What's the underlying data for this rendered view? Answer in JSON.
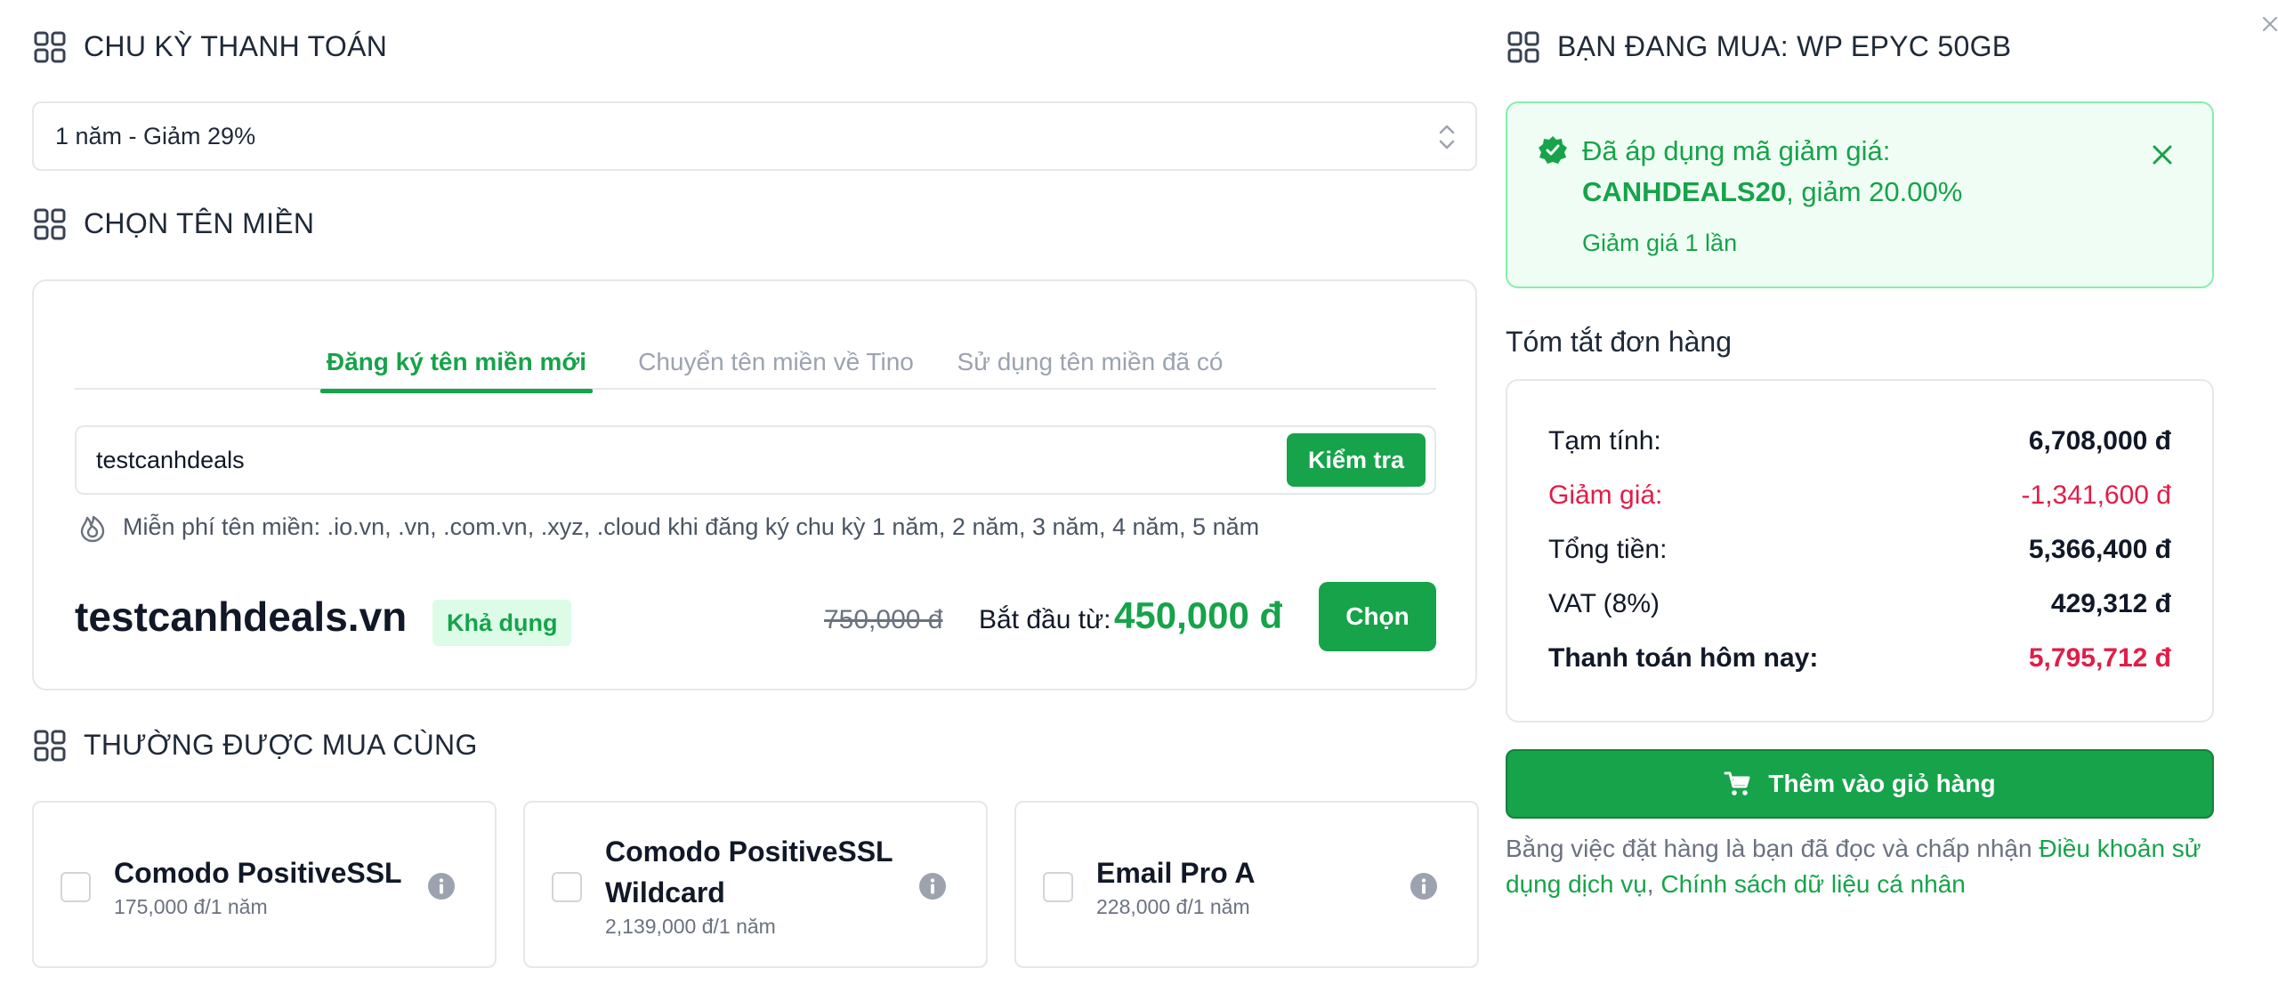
{
  "billing": {
    "section_title": "CHU KỲ THANH TOÁN",
    "selected_option": "1 năm - Giảm 29%"
  },
  "domain": {
    "section_title": "CHỌN TÊN MIỀN",
    "tabs": [
      {
        "label": "Đăng ký tên miền mới",
        "active": true
      },
      {
        "label": "Chuyển tên miền về Tino",
        "active": false
      },
      {
        "label": "Sử dụng tên miền đã có",
        "active": false
      }
    ],
    "search_value": "testcanhdeals",
    "check_button": "Kiểm tra",
    "free_note": "Miễn phí tên miền: .io.vn, .vn, .com.vn, .xyz, .cloud khi đăng ký chu kỳ 1 năm, 2 năm, 3 năm, 4 năm, 5 năm",
    "result": {
      "name": "testcanhdeals.vn",
      "status": "Khả dụng",
      "old_price": "750,000 đ",
      "start_label": "Bắt đầu từ:",
      "new_price": "450,000 đ",
      "choose_button": "Chọn"
    }
  },
  "addons": {
    "section_title": "THƯỜNG ĐƯỢC MUA CÙNG",
    "items": [
      {
        "name": "Comodo PositiveSSL",
        "price": "175,000 đ/1 năm"
      },
      {
        "name": "Comodo PositiveSSL Wildcard",
        "price": "2,139,000 đ/1 năm"
      },
      {
        "name": "Email Pro A",
        "price": "228,000 đ/1 năm"
      }
    ]
  },
  "purchase": {
    "section_title": "BẠN ĐANG MUA: WP EPYC 50GB"
  },
  "promo": {
    "line1": "Đã áp dụng mã giảm giá:",
    "code": "CANHDEALS20",
    "line2_suffix": ", giảm 20.00%",
    "usage": "Giảm giá 1 lần"
  },
  "summary": {
    "title": "Tóm tắt đơn hàng",
    "rows": [
      {
        "label": "Tạm tính:",
        "value": "6,708,000 đ"
      },
      {
        "label": "Giảm giá:",
        "value": "-1,341,600 đ"
      },
      {
        "label": "Tổng tiền:",
        "value": "5,366,400 đ"
      },
      {
        "label": "VAT (8%)",
        "value": "429,312 đ"
      },
      {
        "label": "Thanh toán hôm nay:",
        "value": "5,795,712 đ"
      }
    ]
  },
  "cart_button": "Thêm vào giỏ hàng",
  "terms": {
    "prefix": "Bằng việc đặt hàng là bạn đã đọc và chấp nhận ",
    "link1": "Điều khoản sử dụng dịch vụ",
    "separator": ", ",
    "link2": "Chính sách dữ liệu cá nhân"
  },
  "colors": {
    "brand_green": "#16a34a",
    "discount_red": "#e11d48",
    "promo_bg": "#f0fdf4",
    "border": "#e5e7eb"
  },
  "icons": [
    "grid-icon",
    "select-chevron-icon",
    "fire-icon",
    "info-icon",
    "badge-check-icon",
    "close-icon",
    "cart-icon"
  ]
}
